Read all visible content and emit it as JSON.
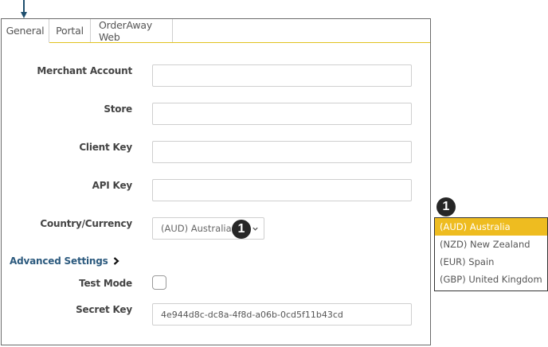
{
  "tabs": [
    "General",
    "Portal",
    "OrderAway Web"
  ],
  "form": {
    "merchant_account_label": "Merchant Account",
    "merchant_account_value": "",
    "store_label": "Store",
    "store_value": "",
    "client_key_label": "Client Key",
    "client_key_value": "",
    "api_key_label": "API Key",
    "api_key_value": "",
    "country_currency_label": "Country/Currency",
    "country_currency_value": "(AUD) Australia",
    "advanced_settings_label": "Advanced Settings",
    "test_mode_label": "Test Mode",
    "test_mode_checked": false,
    "secret_key_label": "Secret Key",
    "secret_key_value": "4e944d8c-dc8a-4f8d-a06b-0cd5f11b43cd"
  },
  "callout": {
    "badge_number": "1"
  },
  "dropdown": {
    "options": [
      "(AUD) Australia",
      "(NZD) New Zealand",
      "(EUR) Spain",
      "(GBP) United Kingdom"
    ],
    "selected_index": 0
  },
  "colors": {
    "accent_yellow": "#eebc20",
    "link_blue": "#2c5a7e",
    "badge_dark": "#262626",
    "indicator_arrow": "#1f4f6e"
  }
}
